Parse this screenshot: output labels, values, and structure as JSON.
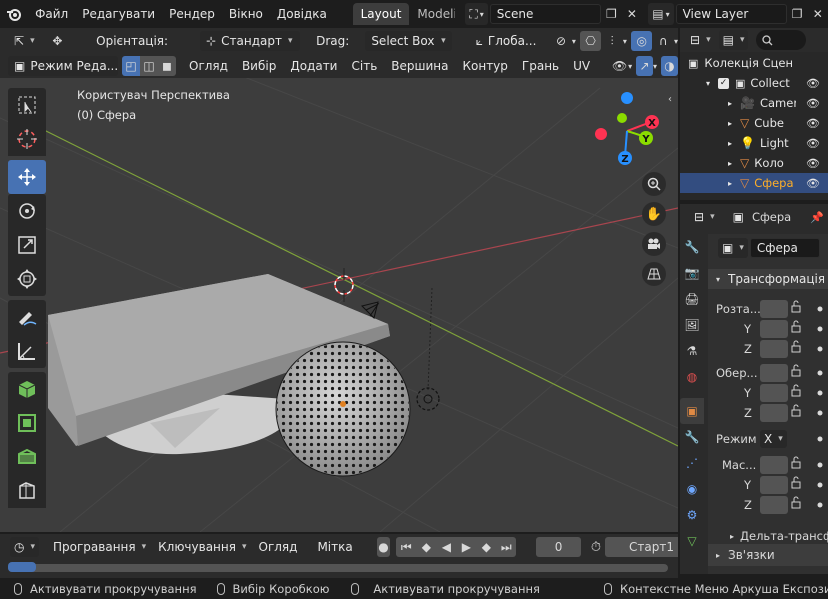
{
  "topbar": {
    "menus": [
      "Файл",
      "Редагувати",
      "Рендер",
      "Вікно",
      "Довідка"
    ],
    "workspace_tabs": [
      "Layout",
      "Modeling"
    ],
    "active_workspace": "Layout",
    "scene_name": "Scene",
    "view_layer": "View Layer"
  },
  "viewport_header": {
    "orientation_label": "Орієнтація:",
    "orientation_value": "Стандарт",
    "drag_label": "Drag:",
    "drag_value": "Select Box",
    "transform_value": "Глоба..."
  },
  "mode_header": {
    "mode": "Режим Реда...",
    "menus": [
      "Огляд",
      "Вибір",
      "Додати",
      "Сіть",
      "Вершина",
      "Контур",
      "Грань",
      "UV"
    ]
  },
  "viewport": {
    "view_name": "Користувач Перспектива",
    "object_info": "(0) Сфера",
    "gizmo_axes": [
      "X",
      "Y",
      "Z"
    ]
  },
  "outliner": {
    "search_placeholder": "",
    "collection_root": "Колекція Сцен",
    "items": [
      {
        "label": "Collect",
        "type": "collection"
      },
      {
        "label": "Camera",
        "type": "camera"
      },
      {
        "label": "Cube",
        "type": "mesh"
      },
      {
        "label": "Light",
        "type": "light"
      },
      {
        "label": "Коло",
        "type": "mesh"
      },
      {
        "label": "Сфера",
        "type": "mesh",
        "selected": true
      }
    ]
  },
  "properties": {
    "object_name": "Сфера",
    "object_field": "Сфера",
    "section_transform": "Трансформація",
    "location_label": "Розта...",
    "rotation_label": "Обер...",
    "mode_label": "Режим",
    "mode_value": "X",
    "scale_label": "Мас...",
    "axis_y": "Y",
    "axis_z": "Z",
    "delta_transform": "Дельта-трансф",
    "relations": "Зв'язки"
  },
  "timeline": {
    "playback": "Програвання",
    "keying": "Ключування",
    "view": "Огляд",
    "marker": "Мітка",
    "current_frame": "0",
    "start_label": "Старт",
    "start_value": "1"
  },
  "statusbar": {
    "items": [
      "Активувати прокручування",
      "Вибір Коробкою",
      "Активувати прокручування",
      "Контекстне Меню Аркуша Експозиції"
    ]
  },
  "colors": {
    "accent": "#4772b3",
    "selected_row": "#334d80",
    "x_axis": "#ff3352",
    "y_axis": "#8bdc00",
    "z_axis": "#2890ff"
  }
}
